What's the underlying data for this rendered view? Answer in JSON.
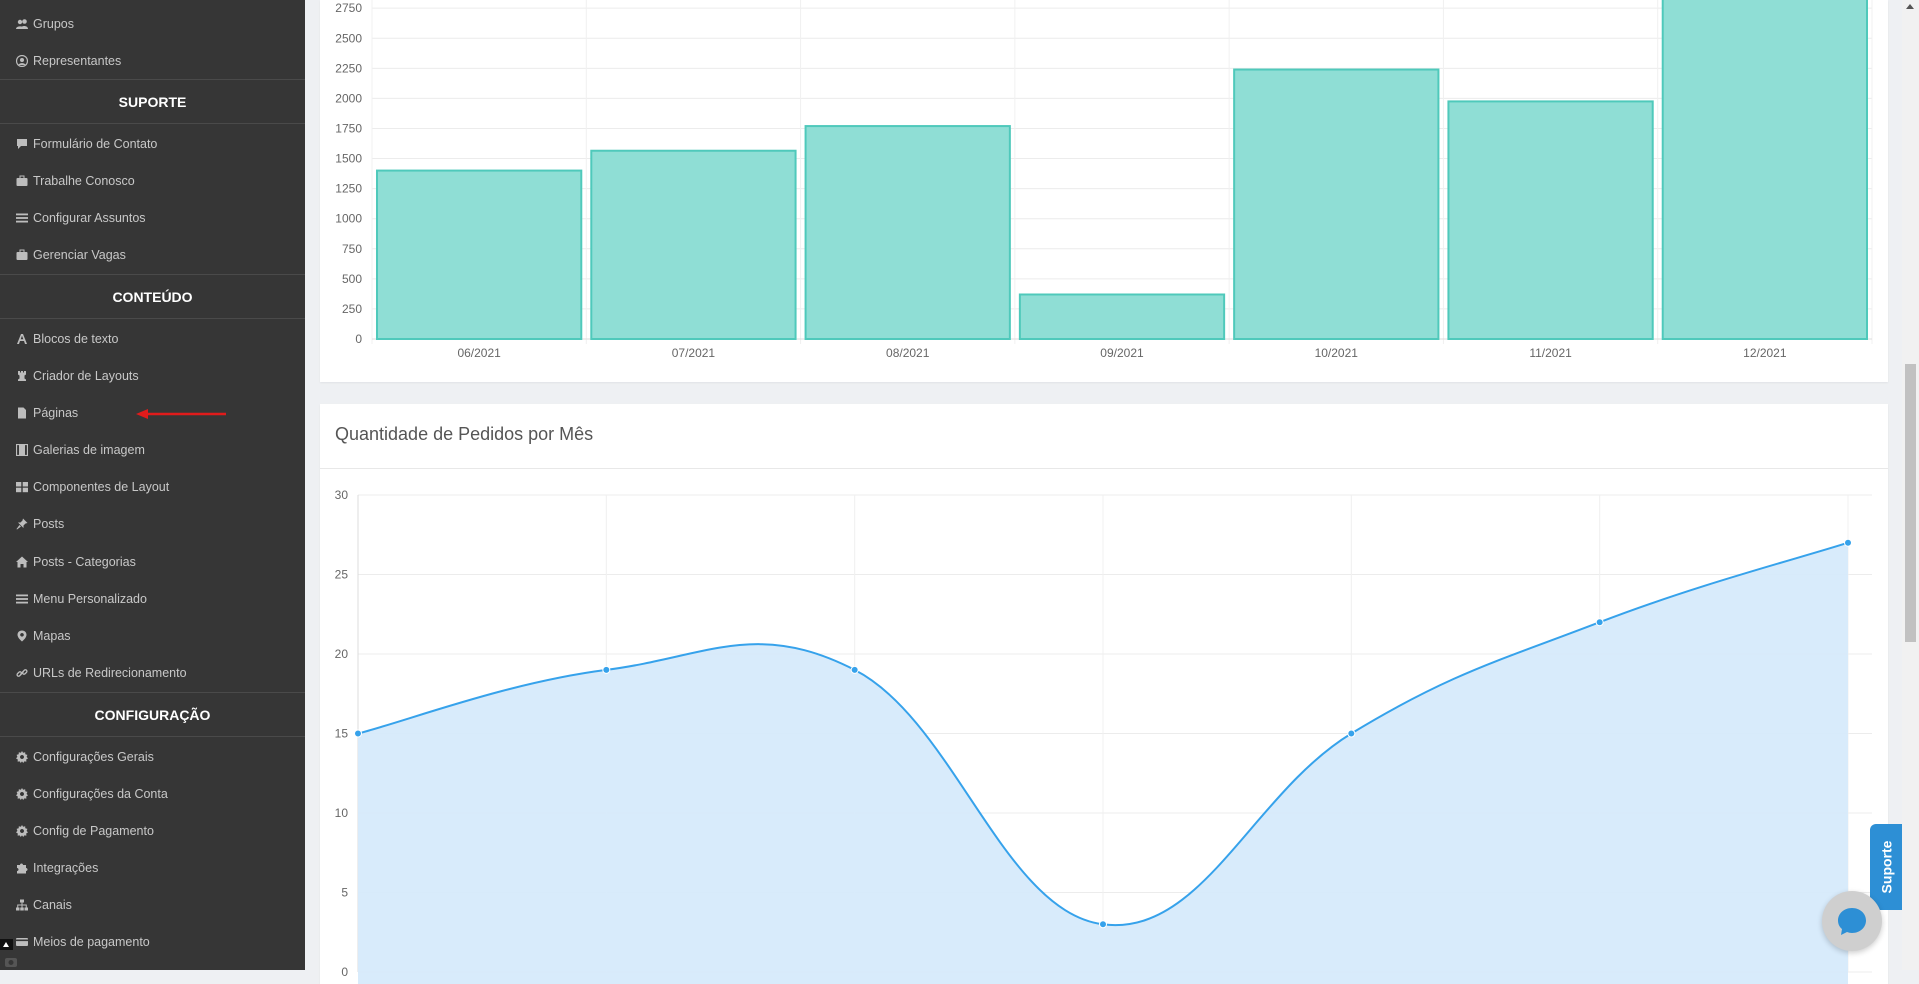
{
  "sidebar": {
    "items_top": [
      {
        "label": "Grupos",
        "icon": "users-icon"
      },
      {
        "label": "Representantes",
        "icon": "user-circle-icon"
      }
    ],
    "sections": [
      {
        "title": "SUPORTE",
        "items": [
          {
            "label": "Formulário de Contato",
            "icon": "comment-icon"
          },
          {
            "label": "Trabalhe Conosco",
            "icon": "briefcase-icon"
          },
          {
            "label": "Configurar Assuntos",
            "icon": "list-icon"
          },
          {
            "label": "Gerenciar Vagas",
            "icon": "briefcase-icon"
          }
        ]
      },
      {
        "title": "CONTEÚDO",
        "items": [
          {
            "label": "Blocos de texto",
            "icon": "font-icon"
          },
          {
            "label": "Criador de Layouts",
            "icon": "chess-rook-icon"
          },
          {
            "label": "Páginas",
            "icon": "file-icon"
          },
          {
            "label": "Galerias de imagem",
            "icon": "film-icon"
          },
          {
            "label": "Componentes de Layout",
            "icon": "th-large-icon"
          },
          {
            "label": "Posts",
            "icon": "thumbtack-icon"
          },
          {
            "label": "Posts - Categorias",
            "icon": "home-icon"
          },
          {
            "label": "Menu Personalizado",
            "icon": "list-icon"
          },
          {
            "label": "Mapas",
            "icon": "map-marker-icon"
          },
          {
            "label": "URLs de Redirecionamento",
            "icon": "link-icon"
          }
        ]
      },
      {
        "title": "CONFIGURAÇÃO",
        "items": [
          {
            "label": "Configurações Gerais",
            "icon": "gear-icon"
          },
          {
            "label": "Configurações da Conta",
            "icon": "gear-icon"
          },
          {
            "label": "Config de Pagamento",
            "icon": "gear-icon"
          },
          {
            "label": "Integrações",
            "icon": "puzzle-icon"
          },
          {
            "label": "Canais",
            "icon": "sitemap-icon"
          },
          {
            "label": "Meios de pagamento",
            "icon": "credit-card-icon"
          }
        ]
      }
    ]
  },
  "colors": {
    "sidebar_bg": "#363636",
    "bar_fill": "#8fded5",
    "bar_stroke": "#4fc9bb",
    "line_stroke": "#36a2eb",
    "line_fill": "#d6eafb",
    "support_blue": "#2d8fd5",
    "annotation_arrow": "#e01b1b"
  },
  "chart_data": [
    {
      "type": "bar",
      "title": "",
      "categories": [
        "06/2021",
        "07/2021",
        "08/2021",
        "09/2021",
        "10/2021",
        "11/2021",
        "12/2021"
      ],
      "values": [
        1400,
        1565,
        1770,
        370,
        2240,
        1975,
        2900
      ],
      "yticks": [
        0,
        250,
        500,
        750,
        1000,
        1250,
        1500,
        1750,
        2000,
        2250,
        2500,
        2750
      ],
      "ylim_visible": [
        0,
        2800
      ],
      "grid": true
    },
    {
      "type": "area",
      "title": "Quantidade de Pedidos por Mês",
      "values": [
        15,
        19,
        19,
        3,
        15,
        22,
        27
      ],
      "yticks": [
        0,
        5,
        10,
        15,
        20,
        25,
        30
      ],
      "ylim": [
        0,
        30
      ],
      "grid": true
    }
  ],
  "support": {
    "tab_label": "Suporte",
    "chat_icon": "chat-bubble-icon"
  }
}
